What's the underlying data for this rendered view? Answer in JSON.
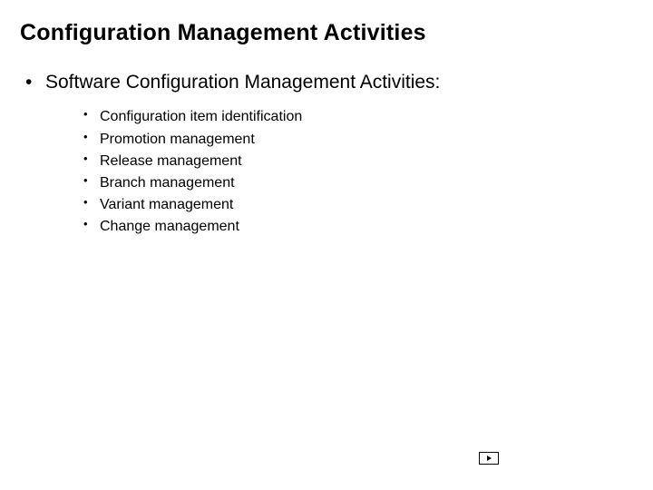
{
  "title": "Configuration Management Activities",
  "lvl1": "Software Configuration Management Activities:",
  "subitems": {
    "0": "Configuration item identification",
    "1": "Promotion management",
    "2": "Release management",
    "3": "Branch management",
    "4": "Variant management",
    "5": "Change management"
  }
}
